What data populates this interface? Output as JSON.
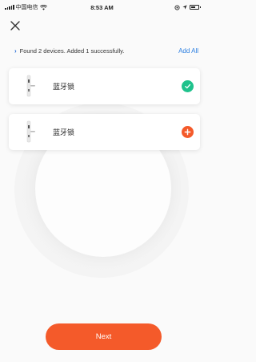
{
  "status_bar": {
    "carrier": "中国电信",
    "time": "8:53 AM"
  },
  "header": {
    "close_icon": "close-icon"
  },
  "scan": {
    "status_text": "Found 2 devices. Added 1 successfully.",
    "add_all_label": "Add All",
    "accent_color": "#2a7ee0"
  },
  "devices": [
    {
      "name": "蓝牙锁",
      "status": "added",
      "status_color": "#1fc28c",
      "icon": "checkmark-icon"
    },
    {
      "name": "蓝牙锁",
      "status": "not-added",
      "status_color": "#f45a2a",
      "icon": "plus-icon"
    }
  ],
  "footer": {
    "next_label": "Next",
    "button_color": "#f45a2a"
  }
}
